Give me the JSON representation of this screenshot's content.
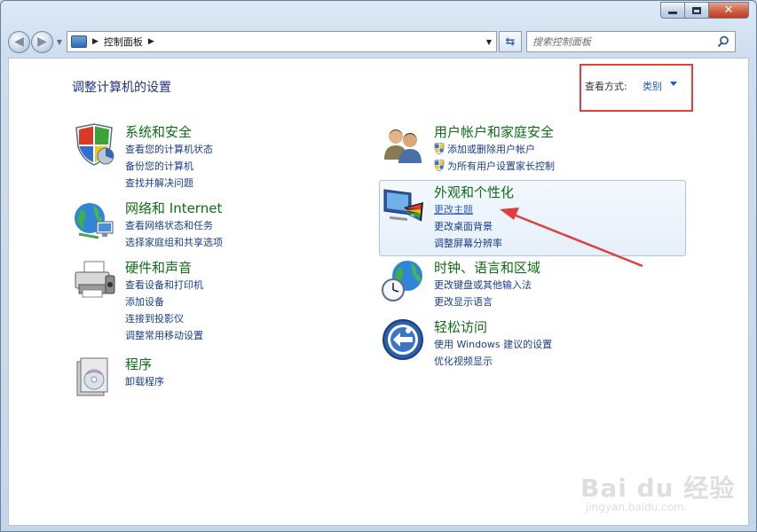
{
  "window": {
    "caption_buttons": {
      "minimize_icon": "minimize-icon",
      "maximize_icon": "maximize-icon",
      "close_icon": "close-icon"
    }
  },
  "nav": {
    "back_icon": "back-arrow-icon",
    "forward_icon": "forward-arrow-icon",
    "breadcrumb": [
      "控制面板"
    ],
    "refresh_icon": "refresh-icon",
    "search_placeholder": "搜索控制面板"
  },
  "header": {
    "title": "调整计算机的设置",
    "view_label": "查看方式:",
    "view_value": "类别"
  },
  "categories_left": [
    {
      "title": "系统和安全",
      "icon": "shield-icon",
      "links": [
        "查看您的计算机状态",
        "备份您的计算机",
        "查找并解决问题"
      ]
    },
    {
      "title": "网络和 Internet",
      "icon": "network-globe-icon",
      "links": [
        "查看网络状态和任务",
        "选择家庭组和共享选项"
      ]
    },
    {
      "title": "硬件和声音",
      "icon": "printer-icon",
      "links": [
        "查看设备和打印机",
        "添加设备",
        "连接到投影仪",
        "调整常用移动设置"
      ]
    },
    {
      "title": "程序",
      "icon": "programs-icon",
      "links": [
        "卸载程序"
      ]
    }
  ],
  "categories_right": [
    {
      "title": "用户帐户和家庭安全",
      "icon": "users-icon",
      "links": [
        "添加或删除用户帐户",
        "为所有用户设置家长控制"
      ]
    },
    {
      "title": "外观和个性化",
      "icon": "monitor-palette-icon",
      "links": [
        "更改主题",
        "更改桌面背景",
        "调整屏幕分辨率"
      ]
    },
    {
      "title": "时钟、语言和区域",
      "icon": "clock-globe-icon",
      "links": [
        "更改键盘或其他输入法",
        "更改显示语言"
      ]
    },
    {
      "title": "轻松访问",
      "icon": "ease-of-access-icon",
      "links": [
        "使用 Windows 建议的设置",
        "优化视频显示"
      ]
    }
  ],
  "watermark": {
    "main": "Bai du 经验",
    "sub": "jingyan.baidu.com"
  },
  "colors": {
    "category_title": "#0f6d16",
    "link": "#1a3d8a",
    "annotation": "#e0403d"
  }
}
